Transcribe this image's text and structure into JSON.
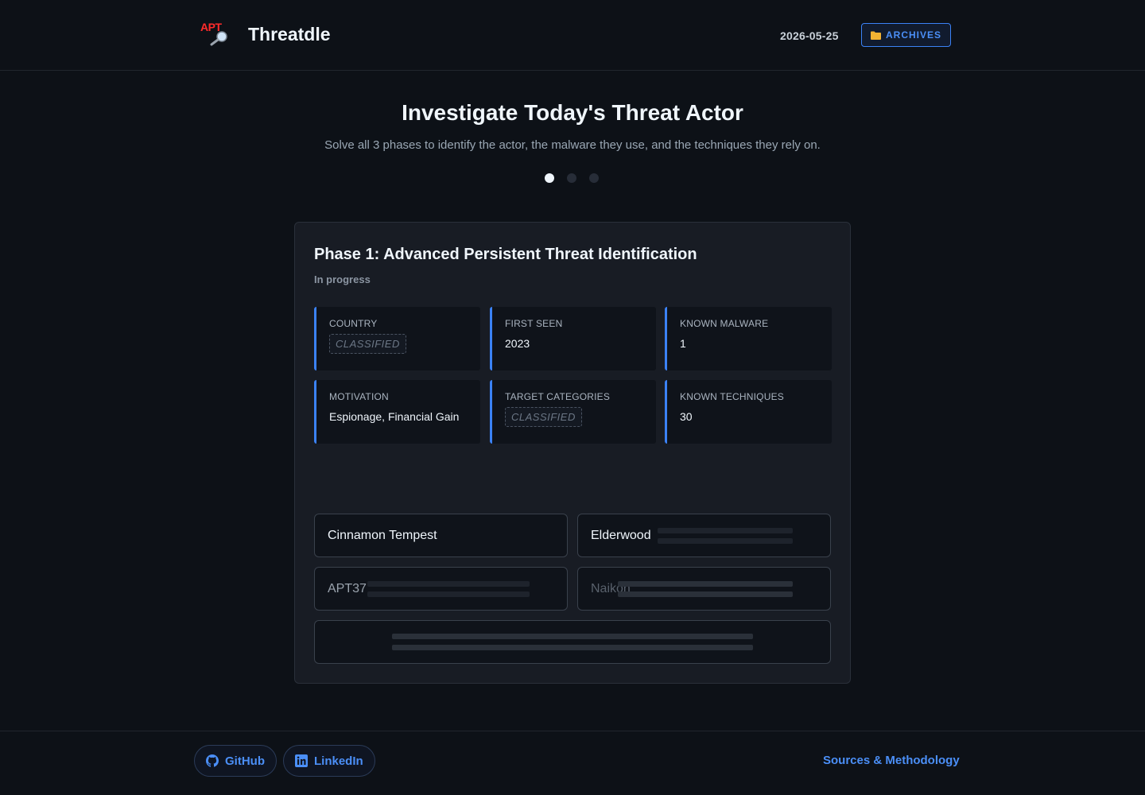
{
  "header": {
    "logo_text": "APT",
    "app_name": "Threatdle",
    "date": "2026-05-25",
    "archives_label": "ARCHIVES",
    "archives_icon": "folder-icon"
  },
  "hero": {
    "title": "Investigate Today's Threat Actor",
    "subtitle": "Solve all 3 phases to identify the actor, the malware they use, and the techniques they rely on.",
    "phases_total": 3,
    "phase_active": 1
  },
  "phase": {
    "title": "Phase 1: Advanced Persistent Threat Identification",
    "status": "In progress",
    "clues": [
      {
        "label": "COUNTRY",
        "value": "CLASSIFIED",
        "classified": true
      },
      {
        "label": "FIRST SEEN",
        "value": "2023",
        "classified": false
      },
      {
        "label": "KNOWN MALWARE",
        "value": "1",
        "classified": false
      },
      {
        "label": "MOTIVATION",
        "value": "Espionage, Financial Gain",
        "classified": false
      },
      {
        "label": "TARGET CATEGORIES",
        "value": "CLASSIFIED",
        "classified": true
      },
      {
        "label": "KNOWN TECHNIQUES",
        "value": "30",
        "classified": false
      }
    ],
    "options": [
      {
        "label": "Cinnamon Tempest"
      },
      {
        "label": "Elderwood"
      },
      {
        "label": "APT37"
      },
      {
        "label": "Naikon"
      },
      {
        "label": ""
      }
    ]
  },
  "footer": {
    "github_label": "GitHub",
    "linkedin_label": "LinkedIn",
    "methodology_label": "Sources & Methodology"
  },
  "colors": {
    "background": "#0d1117",
    "card": "#181c24",
    "accent": "#3b82f6",
    "logo_red": "#ff2b2b"
  }
}
